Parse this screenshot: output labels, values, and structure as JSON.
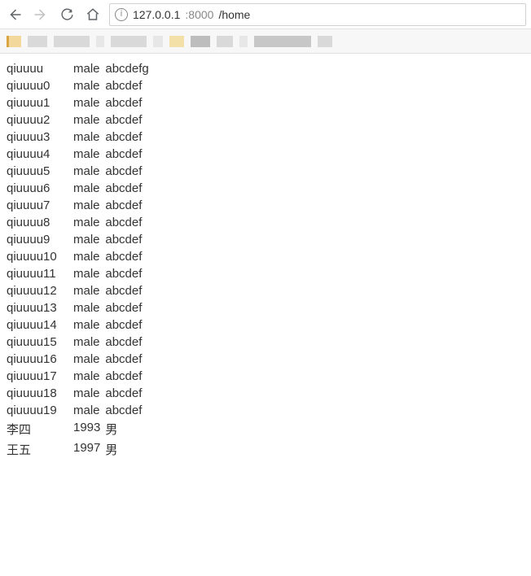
{
  "url": {
    "host": "127.0.0.1",
    "port": ":8000",
    "path": "/home"
  },
  "rows": [
    {
      "c1": "qiuuuu",
      "c2": "male",
      "c3": "abcdefg"
    },
    {
      "c1": "qiuuuu0",
      "c2": "male",
      "c3": "abcdef"
    },
    {
      "c1": "qiuuuu1",
      "c2": "male",
      "c3": "abcdef"
    },
    {
      "c1": "qiuuuu2",
      "c2": "male",
      "c3": "abcdef"
    },
    {
      "c1": "qiuuuu3",
      "c2": "male",
      "c3": "abcdef"
    },
    {
      "c1": "qiuuuu4",
      "c2": "male",
      "c3": "abcdef"
    },
    {
      "c1": "qiuuuu5",
      "c2": "male",
      "c3": "abcdef"
    },
    {
      "c1": "qiuuuu6",
      "c2": "male",
      "c3": "abcdef"
    },
    {
      "c1": "qiuuuu7",
      "c2": "male",
      "c3": "abcdef"
    },
    {
      "c1": "qiuuuu8",
      "c2": "male",
      "c3": "abcdef"
    },
    {
      "c1": "qiuuuu9",
      "c2": "male",
      "c3": "abcdef"
    },
    {
      "c1": "qiuuuu10",
      "c2": "male",
      "c3": "abcdef"
    },
    {
      "c1": "qiuuuu11",
      "c2": "male",
      "c3": "abcdef"
    },
    {
      "c1": "qiuuuu12",
      "c2": "male",
      "c3": "abcdef"
    },
    {
      "c1": "qiuuuu13",
      "c2": "male",
      "c3": "abcdef"
    },
    {
      "c1": "qiuuuu14",
      "c2": "male",
      "c3": "abcdef"
    },
    {
      "c1": "qiuuuu15",
      "c2": "male",
      "c3": "abcdef"
    },
    {
      "c1": "qiuuuu16",
      "c2": "male",
      "c3": "abcdef"
    },
    {
      "c1": "qiuuuu17",
      "c2": "male",
      "c3": "abcdef"
    },
    {
      "c1": "qiuuuu18",
      "c2": "male",
      "c3": "abcdef"
    },
    {
      "c1": "qiuuuu19",
      "c2": "male",
      "c3": "abcdef"
    },
    {
      "c1": "李四",
      "c2": "1993",
      "c3": "男"
    },
    {
      "c1": "王五",
      "c2": "1997",
      "c3": "男"
    }
  ]
}
